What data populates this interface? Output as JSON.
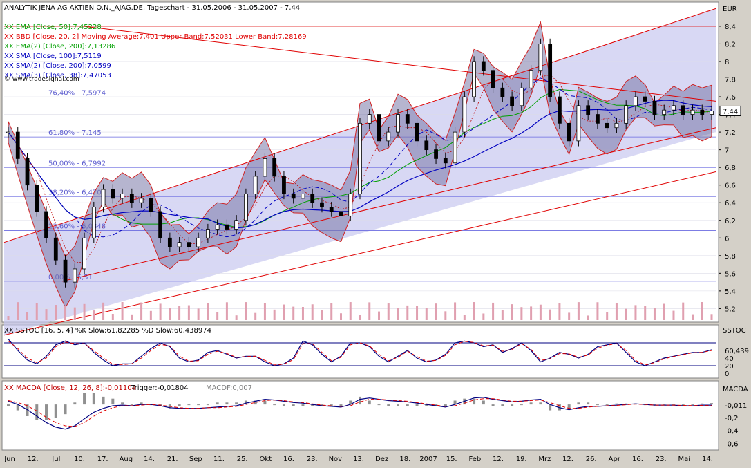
{
  "chart_data": [
    {
      "type": "candlestick",
      "title": "ANALYTIK JENA AG AKTIEN O.N._AJAG.DE, Tageschart - 31.05.2006 - 31.05.2007 - 7,44",
      "currency": "EUR",
      "last_price": "7,44",
      "watermark": "© www.tradesignal.com",
      "y_ticks": [
        "8,4",
        "8,2",
        "8",
        "7,8",
        "7,6",
        "7,4",
        "7,2",
        "7",
        "6,8",
        "6,6",
        "6,4",
        "6,2",
        "6",
        "5,8",
        "5,6",
        "5,4",
        "5,2"
      ],
      "ylim": [
        5.07,
        8.65
      ],
      "x_labels": [
        "Jun",
        "12.",
        "Jul",
        "10.",
        "17.",
        "Aug",
        "14.",
        "21.",
        "Sep",
        "11.",
        "25.",
        "Okt",
        "16.",
        "23.",
        "Nov",
        "13.",
        "Dez",
        "18.",
        "2007",
        "15.",
        "Feb",
        "12.",
        "19.",
        "Mrz",
        "12.",
        "26.",
        "Apr",
        "16.",
        "23.",
        "Mai",
        "14."
      ],
      "indicators": [
        {
          "label": "XX EMA [Close, 50]:7,45228",
          "color": "#00a000"
        },
        {
          "label": "XX BBD [Close, 20, 2] Moving Average:7,401 Upper Band:7,52031 Lower Band:7,28169",
          "color": "#e00000"
        },
        {
          "label": "XX EMA(2) [Close, 200]:7,13286",
          "color": "#00a000"
        },
        {
          "label": "XX SMA [Close, 100]:7,5119",
          "color": "#0000c0"
        },
        {
          "label": "XX SMA(2) [Close, 200]:7,0599",
          "color": "#0000c0"
        },
        {
          "label": "XX SMA(3) [Close, 38]:7,47053",
          "color": "#0000c0"
        }
      ],
      "fibonacci": [
        {
          "label": "76,40% - 7,5974",
          "value": 7.5974
        },
        {
          "label": "61,80% - 7,145",
          "value": 7.145
        },
        {
          "label": "50,00% - 6,7992",
          "value": 6.7992
        },
        {
          "label": "38,20% - 6,4701",
          "value": 6.4701
        },
        {
          "label": "23,60% - 6,0848",
          "value": 6.0848
        },
        {
          "label": "0,00% - 5,51",
          "value": 5.51
        }
      ],
      "close_series": [
        7.2,
        6.9,
        6.6,
        6.3,
        6.0,
        5.75,
        5.5,
        5.65,
        6.0,
        6.35,
        6.55,
        6.45,
        6.5,
        6.4,
        6.45,
        6.3,
        6.0,
        5.9,
        5.95,
        5.9,
        6.0,
        6.1,
        6.15,
        6.1,
        6.2,
        6.5,
        6.7,
        6.9,
        6.7,
        6.5,
        6.45,
        6.5,
        6.4,
        6.35,
        6.3,
        6.25,
        6.5,
        7.3,
        7.4,
        7.1,
        7.2,
        7.4,
        7.3,
        7.1,
        7.0,
        6.9,
        6.85,
        7.2,
        7.6,
        8.0,
        7.9,
        7.7,
        7.6,
        7.5,
        7.7,
        7.9,
        8.2,
        7.6,
        7.3,
        7.1,
        7.5,
        7.4,
        7.3,
        7.25,
        7.3,
        7.5,
        7.6,
        7.55,
        7.4,
        7.45,
        7.5,
        7.4,
        7.45,
        7.4,
        7.44
      ]
    },
    {
      "type": "line",
      "title": "XX SSTOC [16, 5, 4] %K Slow:61,82285 %D Slow:60,438974",
      "axis_label": "SSTOC",
      "value_label": "60,439",
      "y_ticks": [
        "40",
        "20",
        "0"
      ],
      "ylim": [
        0,
        100
      ],
      "levels": [
        20,
        80
      ],
      "series": [
        {
          "name": "%K Slow",
          "values": [
            90,
            60,
            35,
            25,
            45,
            75,
            85,
            75,
            80,
            55,
            35,
            20,
            25,
            25,
            45,
            65,
            80,
            70,
            40,
            30,
            35,
            55,
            60,
            50,
            40,
            45,
            45,
            30,
            20,
            25,
            40,
            85,
            75,
            50,
            30,
            45,
            80,
            80,
            70,
            45,
            30,
            45,
            60,
            40,
            30,
            35,
            50,
            80,
            85,
            80,
            70,
            75,
            55,
            65,
            80,
            60,
            30,
            40,
            55,
            50,
            40,
            50,
            70,
            75,
            80,
            55,
            30,
            20,
            30,
            40,
            45,
            50,
            55,
            55,
            62
          ]
        },
        {
          "name": "%D Slow",
          "values": [
            85,
            65,
            40,
            28,
            40,
            70,
            82,
            78,
            78,
            60,
            40,
            24,
            23,
            25,
            40,
            60,
            76,
            72,
            45,
            32,
            33,
            50,
            58,
            52,
            42,
            44,
            45,
            34,
            22,
            24,
            36,
            78,
            78,
            55,
            33,
            42,
            75,
            80,
            72,
            50,
            33,
            42,
            58,
            44,
            32,
            34,
            47,
            75,
            84,
            81,
            72,
            74,
            58,
            63,
            78,
            63,
            34,
            38,
            52,
            51,
            42,
            48,
            66,
            74,
            78,
            60,
            34,
            22,
            28,
            38,
            44,
            49,
            54,
            55,
            60
          ]
        }
      ]
    },
    {
      "type": "line",
      "title": "XX MACDA [Close, 12, 26, 8]:-0,01104",
      "trigger_label": "Trigger:-0,01804",
      "macdf_label": "MACDF:0,007",
      "axis_label": "MACDA",
      "value_label": "-0,011",
      "y_ticks": [
        "-0,2",
        "-0,4",
        "-0,6"
      ],
      "ylim": [
        -0.65,
        0.14
      ],
      "series": [
        {
          "name": "MACDA",
          "values": [
            0.05,
            0.0,
            -0.08,
            -0.18,
            -0.28,
            -0.35,
            -0.38,
            -0.33,
            -0.22,
            -0.12,
            -0.06,
            -0.02,
            -0.01,
            -0.02,
            0.0,
            0.0,
            -0.02,
            -0.05,
            -0.06,
            -0.06,
            -0.06,
            -0.05,
            -0.04,
            -0.03,
            -0.02,
            0.02,
            0.05,
            0.08,
            0.07,
            0.05,
            0.03,
            0.02,
            0.0,
            -0.02,
            -0.03,
            -0.04,
            0.0,
            0.08,
            0.1,
            0.08,
            0.06,
            0.05,
            0.04,
            0.02,
            0.0,
            -0.02,
            -0.04,
            0.0,
            0.05,
            0.1,
            0.11,
            0.08,
            0.06,
            0.04,
            0.05,
            0.07,
            0.08,
            0.0,
            -0.05,
            -0.08,
            -0.05,
            -0.03,
            -0.03,
            -0.02,
            -0.01,
            0.0,
            0.01,
            0.0,
            -0.01,
            -0.01,
            -0.01,
            -0.02,
            -0.02,
            -0.01,
            -0.011
          ]
        },
        {
          "name": "Trigger",
          "values": [
            0.06,
            0.03,
            -0.02,
            -0.1,
            -0.2,
            -0.28,
            -0.33,
            -0.34,
            -0.28,
            -0.18,
            -0.1,
            -0.05,
            -0.02,
            -0.02,
            -0.01,
            0.0,
            -0.01,
            -0.03,
            -0.05,
            -0.06,
            -0.06,
            -0.05,
            -0.05,
            -0.04,
            -0.03,
            0.0,
            0.03,
            0.06,
            0.07,
            0.06,
            0.04,
            0.03,
            0.01,
            -0.01,
            -0.02,
            -0.03,
            -0.02,
            0.04,
            0.08,
            0.08,
            0.07,
            0.06,
            0.05,
            0.03,
            0.01,
            -0.01,
            -0.03,
            -0.02,
            0.02,
            0.07,
            0.09,
            0.09,
            0.07,
            0.05,
            0.05,
            0.06,
            0.07,
            0.03,
            -0.02,
            -0.06,
            -0.06,
            -0.04,
            -0.03,
            -0.02,
            -0.015,
            -0.005,
            0.005,
            0.0,
            -0.01,
            -0.01,
            -0.01,
            -0.015,
            -0.018,
            -0.015,
            -0.018
          ]
        }
      ]
    }
  ]
}
